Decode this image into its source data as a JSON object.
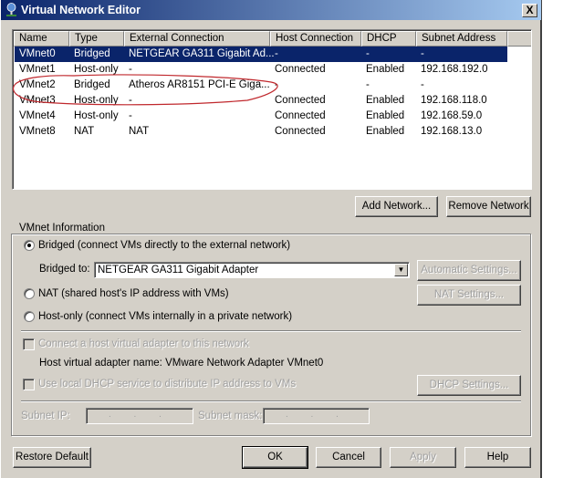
{
  "window": {
    "title": "Virtual Network Editor",
    "close_label": "X"
  },
  "table": {
    "columns": [
      "Name",
      "Type",
      "External Connection",
      "Host Connection",
      "DHCP",
      "Subnet Address"
    ],
    "rows": [
      [
        "VMnet0",
        "Bridged",
        "NETGEAR GA311 Gigabit Ad...",
        "-",
        "-",
        "-"
      ],
      [
        "VMnet1",
        "Host-only",
        "-",
        "Connected",
        "Enabled",
        "192.168.192.0"
      ],
      [
        "VMnet2",
        "Bridged",
        "Atheros AR8151 PCI-E Giga...",
        "-",
        "-",
        "-"
      ],
      [
        "VMnet3",
        "Host-only",
        "-",
        "Connected",
        "Enabled",
        "192.168.118.0"
      ],
      [
        "VMnet4",
        "Host-only",
        "-",
        "Connected",
        "Enabled",
        "192.168.59.0"
      ],
      [
        "VMnet8",
        "NAT",
        "NAT",
        "Connected",
        "Enabled",
        "192.168.13.0"
      ]
    ],
    "selected_row": 0,
    "annotation_color": "#c0282d"
  },
  "buttons": {
    "add_network": "Add Network...",
    "remove_network": "Remove Network"
  },
  "info": {
    "legend": "VMnet Information",
    "bridged": "Bridged (connect VMs directly to the external network)",
    "bridged_to_label": "Bridged to:",
    "bridged_to_value": "NETGEAR GA311 Gigabit Adapter",
    "automatic_settings": "Automatic Settings...",
    "nat": "NAT (shared host's IP address with VMs)",
    "nat_settings": "NAT Settings...",
    "host_only": "Host-only (connect VMs internally in a private network)",
    "connect_adapter": "Connect a host virtual adapter to this network",
    "adapter_name": "Host virtual adapter name: VMware Network Adapter VMnet0",
    "use_dhcp": "Use local DHCP service to distribute IP address to VMs",
    "dhcp_settings": "DHCP Settings...",
    "subnet_ip_label": "Subnet IP:",
    "subnet_ip_value": ". . .",
    "subnet_mask_label": "Subnet mask:",
    "subnet_mask_value": ". . .",
    "selected_mode": "bridged"
  },
  "footer": {
    "restore_default": "Restore Default",
    "ok": "OK",
    "cancel": "Cancel",
    "apply": "Apply",
    "help": "Help"
  }
}
